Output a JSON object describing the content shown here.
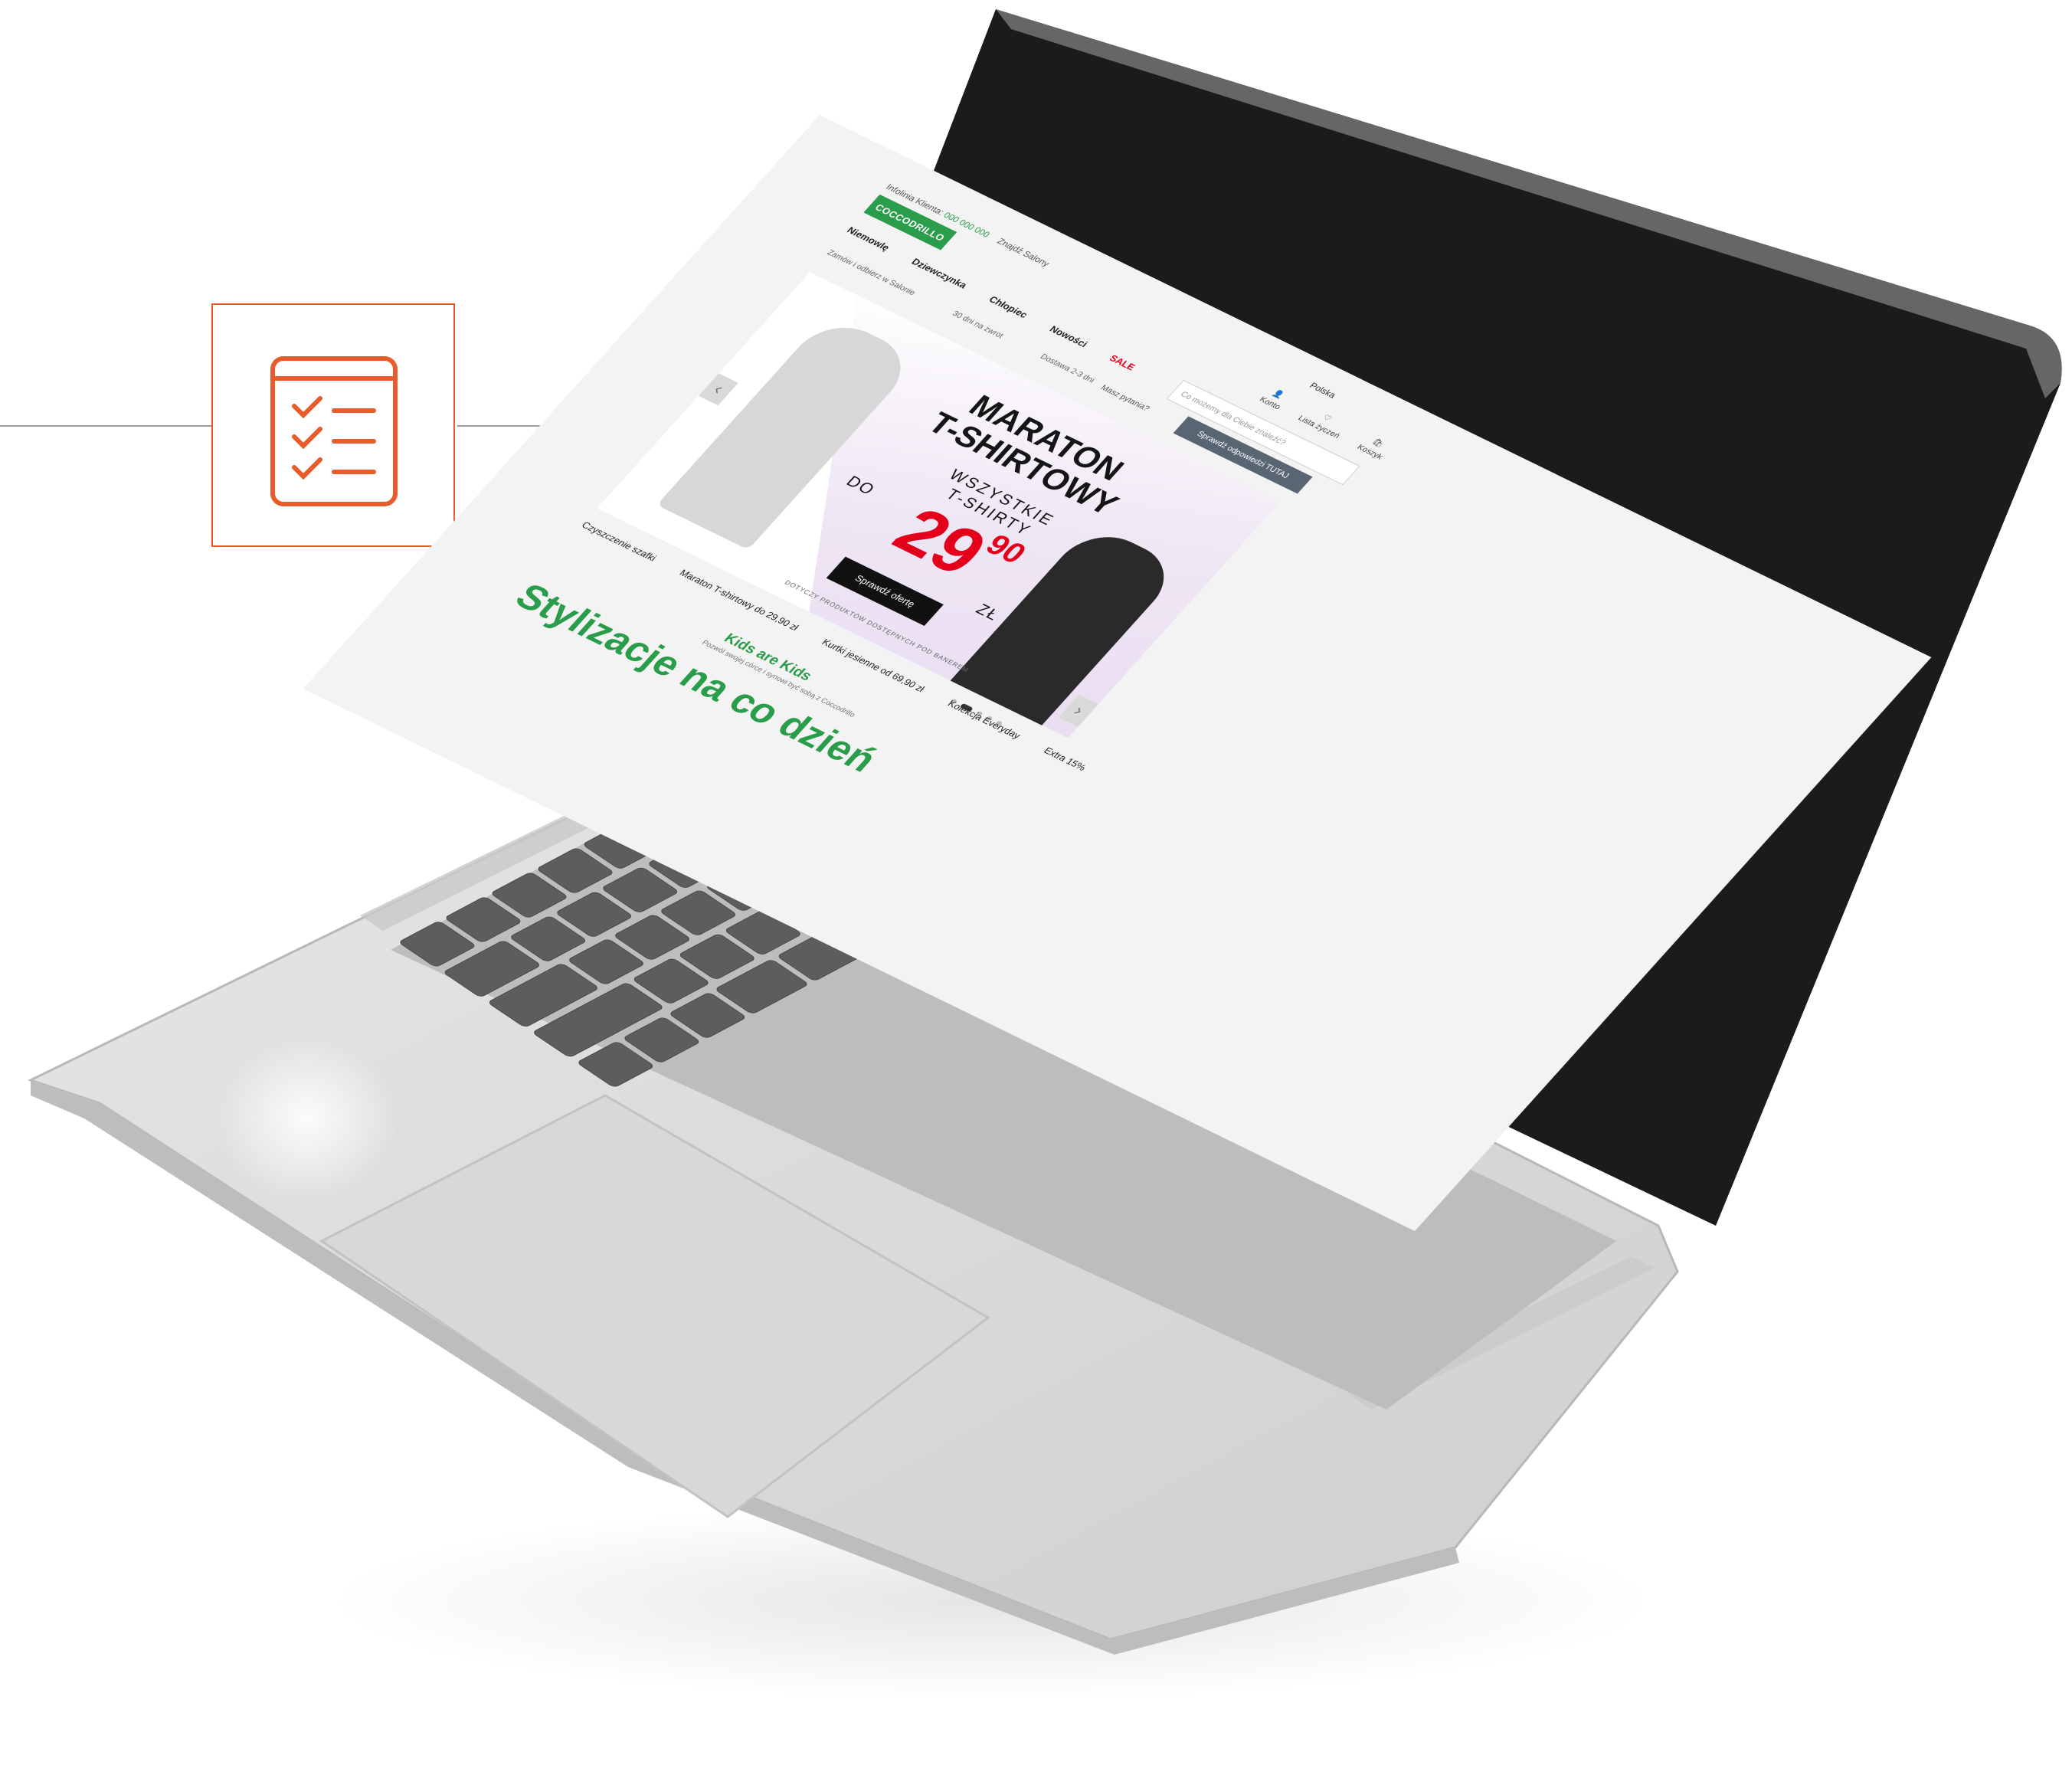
{
  "site": {
    "topline_label": "Infolinia Klienta:",
    "topline_phone": "000 000 000",
    "stores_label": "Znajdź Salony",
    "logo_text": "COCCODRILLO",
    "country": "Polska",
    "nav": [
      "Niemowlę",
      "Dziewczynka",
      "Chłopiec",
      "Nowości",
      "SALE"
    ],
    "benefits": [
      "Zamów i odbierz w Salonie",
      "30 dni na zwrot",
      "Dostawa 2-3 dni"
    ],
    "icons": [
      {
        "name": "Konto",
        "glyph": "👤"
      },
      {
        "name": "Lista życzeń",
        "glyph": "♡"
      },
      {
        "name": "Koszyk",
        "glyph": "🛍"
      }
    ],
    "search_placeholder": "Co możemy dla Ciebie znaleźć?",
    "ask_label": "Masz pytania?",
    "answers_label": "Sprawdź odpowiedzi TUTAJ",
    "hero": {
      "headline_1": "MARATON",
      "headline_2": "T-SHIRTOWY",
      "sub_1": "WSZYSTKIE",
      "sub_2": "T-SHIRTY",
      "price_prefix": "DO",
      "price_main": "29",
      "price_cents": "90",
      "price_unit": "ZŁ",
      "cta": "Sprawdź ofertę",
      "terms": "DOTYCZY PRODUKTÓW DOSTĘPNYCH POD BANEREM",
      "prev_arrow": "‹",
      "next_arrow": "›"
    },
    "carousel_dots": 5,
    "carousel_active": 1,
    "bottom_links": [
      "Czyszczenie szafki",
      "Maraton T-shirtowy do 29,90 zł",
      "Kurtki jesienne od 69,90 zł",
      "Kolekcja Everyday",
      "Extra 15%"
    ],
    "kids_title": "Kids are Kids",
    "kids_sub": "Pozwól swojej córce i synowi być sobą z Coccodrillo",
    "section_title": "Stylizacje na co dzień"
  },
  "colors": {
    "accent_orange": "#e85b2a",
    "brand_green": "#2a9d4a",
    "price_red": "#e4001b"
  },
  "card_icon": "checklist-icon"
}
